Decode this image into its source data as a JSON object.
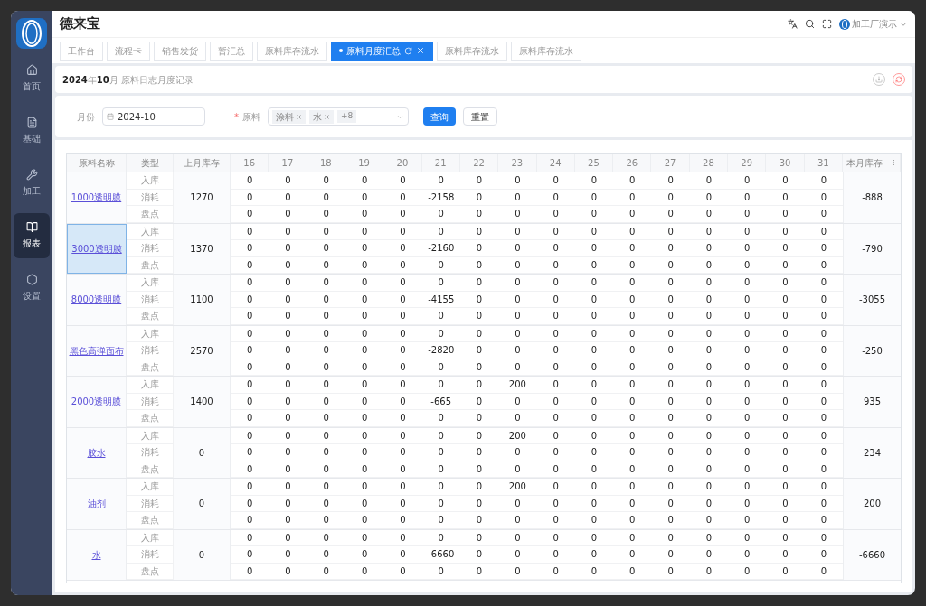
{
  "app": {
    "title": "德来宝",
    "user": "加工厂演示"
  },
  "sidebar": {
    "items": [
      {
        "label": "首页",
        "selected": false
      },
      {
        "label": "基础",
        "selected": false
      },
      {
        "label": "加工",
        "selected": false
      },
      {
        "label": "报表",
        "selected": true
      },
      {
        "label": "设置",
        "selected": false
      }
    ]
  },
  "tabs": [
    {
      "label": "工作台",
      "selected": false
    },
    {
      "label": "流程卡",
      "selected": false
    },
    {
      "label": "销售发货",
      "selected": false
    },
    {
      "label": "暂汇总",
      "selected": false
    },
    {
      "label": "原料库存流水",
      "selected": false
    },
    {
      "label": "原料月度汇总",
      "selected": true
    },
    {
      "label": "原料库存流水",
      "selected": false
    },
    {
      "label": "原料库存流水",
      "selected": false
    }
  ],
  "report_title": {
    "year": "2024",
    "year_unit": "年",
    "month": "10",
    "rest": "月 原料日志月度记录"
  },
  "filters": {
    "month_label": "月份",
    "month_value": "2024-10",
    "required_mark": "*",
    "material_label": "原料",
    "material_tags": [
      "涂料",
      "水"
    ],
    "more_count": "+8",
    "query_button": "查询",
    "reset_button": "重置"
  },
  "table": {
    "columns": [
      "原料名称",
      "类型",
      "上月库存",
      "16",
      "17",
      "18",
      "19",
      "20",
      "21",
      "22",
      "23",
      "24",
      "25",
      "26",
      "27",
      "28",
      "29",
      "30",
      "31",
      "本月库存"
    ],
    "materials": [
      {
        "name": "1000透明膜",
        "selected": false,
        "prev_stock": "1270",
        "month_stock": "-888",
        "rows": [
          {
            "type": "入库",
            "values": [
              "0",
              "0",
              "0",
              "0",
              "0",
              "0",
              "0",
              "0",
              "0",
              "0",
              "0",
              "0",
              "0",
              "0",
              "0",
              "0"
            ]
          },
          {
            "type": "消耗",
            "values": [
              "0",
              "0",
              "0",
              "0",
              "0",
              "-2158",
              "0",
              "0",
              "0",
              "0",
              "0",
              "0",
              "0",
              "0",
              "0",
              "0"
            ]
          },
          {
            "type": "盘点",
            "values": [
              "0",
              "0",
              "0",
              "0",
              "0",
              "0",
              "0",
              "0",
              "0",
              "0",
              "0",
              "0",
              "0",
              "0",
              "0",
              "0"
            ]
          }
        ]
      },
      {
        "name": "3000透明膜",
        "selected": true,
        "prev_stock": "1370",
        "month_stock": "-790",
        "rows": [
          {
            "type": "入库",
            "values": [
              "0",
              "0",
              "0",
              "0",
              "0",
              "0",
              "0",
              "0",
              "0",
              "0",
              "0",
              "0",
              "0",
              "0",
              "0",
              "0"
            ]
          },
          {
            "type": "消耗",
            "values": [
              "0",
              "0",
              "0",
              "0",
              "0",
              "-2160",
              "0",
              "0",
              "0",
              "0",
              "0",
              "0",
              "0",
              "0",
              "0",
              "0"
            ]
          },
          {
            "type": "盘点",
            "values": [
              "0",
              "0",
              "0",
              "0",
              "0",
              "0",
              "0",
              "0",
              "0",
              "0",
              "0",
              "0",
              "0",
              "0",
              "0",
              "0"
            ]
          }
        ]
      },
      {
        "name": "8000透明膜",
        "selected": false,
        "prev_stock": "1100",
        "month_stock": "-3055",
        "rows": [
          {
            "type": "入库",
            "values": [
              "0",
              "0",
              "0",
              "0",
              "0",
              "0",
              "0",
              "0",
              "0",
              "0",
              "0",
              "0",
              "0",
              "0",
              "0",
              "0"
            ]
          },
          {
            "type": "消耗",
            "values": [
              "0",
              "0",
              "0",
              "0",
              "0",
              "-4155",
              "0",
              "0",
              "0",
              "0",
              "0",
              "0",
              "0",
              "0",
              "0",
              "0"
            ]
          },
          {
            "type": "盘点",
            "values": [
              "0",
              "0",
              "0",
              "0",
              "0",
              "0",
              "0",
              "0",
              "0",
              "0",
              "0",
              "0",
              "0",
              "0",
              "0",
              "0"
            ]
          }
        ]
      },
      {
        "name": "黑色高弹面布",
        "selected": false,
        "prev_stock": "2570",
        "month_stock": "-250",
        "rows": [
          {
            "type": "入库",
            "values": [
              "0",
              "0",
              "0",
              "0",
              "0",
              "0",
              "0",
              "0",
              "0",
              "0",
              "0",
              "0",
              "0",
              "0",
              "0",
              "0"
            ]
          },
          {
            "type": "消耗",
            "values": [
              "0",
              "0",
              "0",
              "0",
              "0",
              "-2820",
              "0",
              "0",
              "0",
              "0",
              "0",
              "0",
              "0",
              "0",
              "0",
              "0"
            ]
          },
          {
            "type": "盘点",
            "values": [
              "0",
              "0",
              "0",
              "0",
              "0",
              "0",
              "0",
              "0",
              "0",
              "0",
              "0",
              "0",
              "0",
              "0",
              "0",
              "0"
            ]
          }
        ]
      },
      {
        "name": "2000透明膜",
        "selected": false,
        "prev_stock": "1400",
        "month_stock": "935",
        "rows": [
          {
            "type": "入库",
            "values": [
              "0",
              "0",
              "0",
              "0",
              "0",
              "0",
              "0",
              "200",
              "0",
              "0",
              "0",
              "0",
              "0",
              "0",
              "0",
              "0"
            ]
          },
          {
            "type": "消耗",
            "values": [
              "0",
              "0",
              "0",
              "0",
              "0",
              "-665",
              "0",
              "0",
              "0",
              "0",
              "0",
              "0",
              "0",
              "0",
              "0",
              "0"
            ]
          },
          {
            "type": "盘点",
            "values": [
              "0",
              "0",
              "0",
              "0",
              "0",
              "0",
              "0",
              "0",
              "0",
              "0",
              "0",
              "0",
              "0",
              "0",
              "0",
              "0"
            ]
          }
        ]
      },
      {
        "name": "胶水",
        "selected": false,
        "prev_stock": "0",
        "month_stock": "234",
        "rows": [
          {
            "type": "入库",
            "values": [
              "0",
              "0",
              "0",
              "0",
              "0",
              "0",
              "0",
              "200",
              "0",
              "0",
              "0",
              "0",
              "0",
              "0",
              "0",
              "0"
            ]
          },
          {
            "type": "消耗",
            "values": [
              "0",
              "0",
              "0",
              "0",
              "0",
              "0",
              "0",
              "0",
              "0",
              "0",
              "0",
              "0",
              "0",
              "0",
              "0",
              "0"
            ]
          },
          {
            "type": "盘点",
            "values": [
              "0",
              "0",
              "0",
              "0",
              "0",
              "0",
              "0",
              "0",
              "0",
              "0",
              "0",
              "0",
              "0",
              "0",
              "0",
              "0"
            ]
          }
        ]
      },
      {
        "name": "油剂",
        "selected": false,
        "prev_stock": "0",
        "month_stock": "200",
        "rows": [
          {
            "type": "入库",
            "values": [
              "0",
              "0",
              "0",
              "0",
              "0",
              "0",
              "0",
              "200",
              "0",
              "0",
              "0",
              "0",
              "0",
              "0",
              "0",
              "0"
            ]
          },
          {
            "type": "消耗",
            "values": [
              "0",
              "0",
              "0",
              "0",
              "0",
              "0",
              "0",
              "0",
              "0",
              "0",
              "0",
              "0",
              "0",
              "0",
              "0",
              "0"
            ]
          },
          {
            "type": "盘点",
            "values": [
              "0",
              "0",
              "0",
              "0",
              "0",
              "0",
              "0",
              "0",
              "0",
              "0",
              "0",
              "0",
              "0",
              "0",
              "0",
              "0"
            ]
          }
        ]
      },
      {
        "name": "水",
        "selected": false,
        "prev_stock": "0",
        "month_stock": "-6660",
        "rows": [
          {
            "type": "入库",
            "values": [
              "0",
              "0",
              "0",
              "0",
              "0",
              "0",
              "0",
              "0",
              "0",
              "0",
              "0",
              "0",
              "0",
              "0",
              "0",
              "0"
            ]
          },
          {
            "type": "消耗",
            "values": [
              "0",
              "0",
              "0",
              "0",
              "0",
              "-6660",
              "0",
              "0",
              "0",
              "0",
              "0",
              "0",
              "0",
              "0",
              "0",
              "0"
            ]
          },
          {
            "type": "盘点",
            "values": [
              "0",
              "0",
              "0",
              "0",
              "0",
              "0",
              "0",
              "0",
              "0",
              "0",
              "0",
              "0",
              "0",
              "0",
              "0",
              "0"
            ]
          }
        ]
      }
    ]
  }
}
